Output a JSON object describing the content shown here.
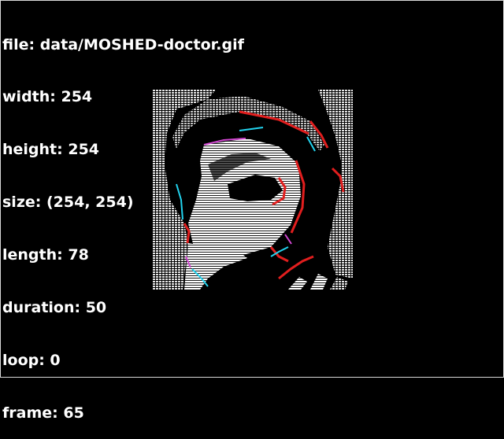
{
  "window": {
    "background": "#000000",
    "border_color": "#d9d9d9"
  },
  "info": {
    "file": "file: data/MOSHED-doctor.gif",
    "width": "width: 254",
    "height": "height: 254",
    "size": "size: (254, 254)",
    "length": "length: 78",
    "duration": "duration: 50",
    "loop": "loop: 0",
    "frame": "frame: 65"
  },
  "image": {
    "icon": "moshed-doctor-gif-frame",
    "palette": {
      "light": "#e6e6e6",
      "red": "#e11e1e",
      "cyan": "#22d3ee",
      "magenta": "#d046d0"
    }
  }
}
